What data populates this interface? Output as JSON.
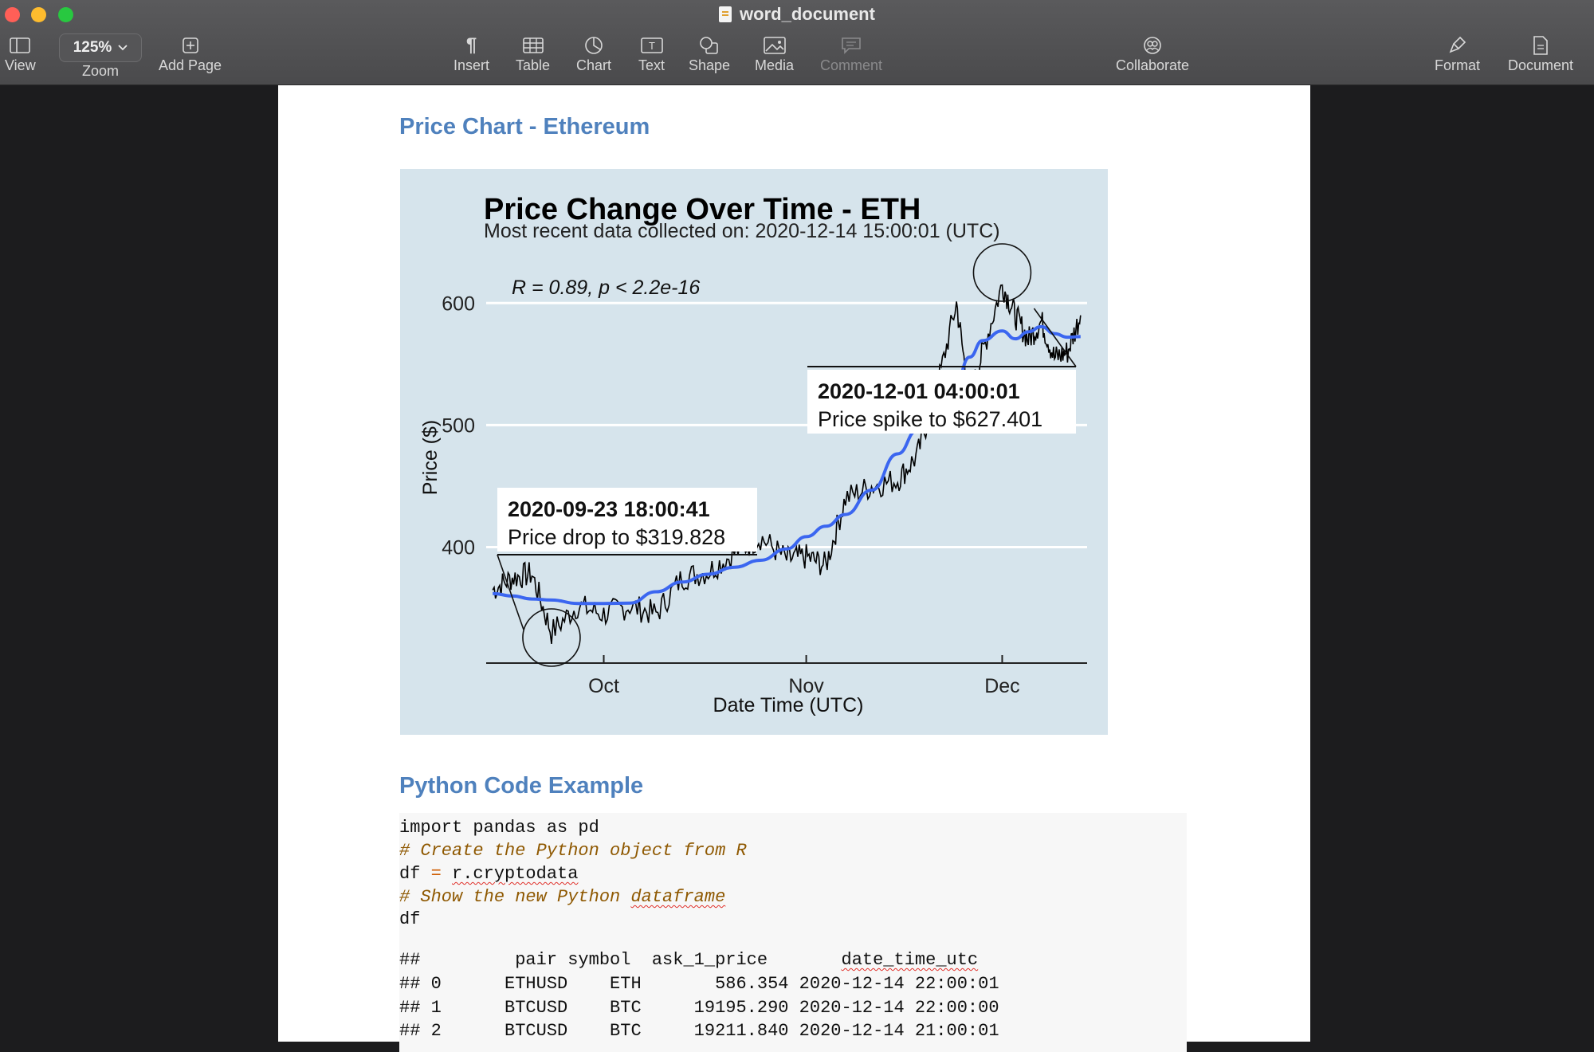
{
  "window": {
    "title": "word_document"
  },
  "toolbar": {
    "view": "View",
    "zoom_value": "125%",
    "zoom": "Zoom",
    "add_page": "Add Page",
    "insert": "Insert",
    "table": "Table",
    "chart": "Chart",
    "text": "Text",
    "shape": "Shape",
    "media": "Media",
    "comment": "Comment",
    "collaborate": "Collaborate",
    "format": "Format",
    "document": "Document"
  },
  "document": {
    "heading1": "Price Chart - Ethereum",
    "heading2": "Python Code Example"
  },
  "chart_data": {
    "type": "line",
    "title": "Price Change Over Time - ETH",
    "subtitle": "Most recent data collected on: 2020-12-14 15:00:01 (UTC)",
    "xlabel": "Date Time (UTC)",
    "ylabel": "Price ($)",
    "x_ticks": [
      "Oct",
      "Nov",
      "Dec"
    ],
    "y_ticks": [
      400,
      500,
      600
    ],
    "ylim": [
      305,
      625
    ],
    "xlim": [
      "2020-09-13",
      "2020-12-14"
    ],
    "grid": true,
    "stat_label": "R = 0.89, p < 2.2e-16",
    "series": [
      {
        "values_by_date": [
          [
            "2020-09-14",
            365
          ],
          [
            "2020-09-17",
            375
          ],
          [
            "2020-09-20",
            378
          ],
          [
            "2020-09-23",
            330
          ],
          [
            "2020-09-27",
            352
          ],
          [
            "2020-10-01",
            345
          ],
          [
            "2020-10-05",
            352
          ],
          [
            "2020-10-09",
            345
          ],
          [
            "2020-10-13",
            375
          ],
          [
            "2020-10-17",
            380
          ],
          [
            "2020-10-21",
            395
          ],
          [
            "2020-10-25",
            408
          ],
          [
            "2020-10-29",
            390
          ],
          [
            "2020-11-01",
            392
          ],
          [
            "2020-11-04",
            385
          ],
          [
            "2020-11-07",
            440
          ],
          [
            "2020-11-11",
            450
          ],
          [
            "2020-11-15",
            455
          ],
          [
            "2020-11-18",
            475
          ],
          [
            "2020-11-21",
            530
          ],
          [
            "2020-11-24",
            600
          ],
          [
            "2020-11-26",
            520
          ],
          [
            "2020-11-28",
            560
          ],
          [
            "2020-12-01",
            615
          ],
          [
            "2020-12-03",
            590
          ],
          [
            "2020-12-05",
            570
          ],
          [
            "2020-12-07",
            585
          ],
          [
            "2020-12-09",
            555
          ],
          [
            "2020-12-11",
            560
          ],
          [
            "2020-12-13",
            590
          ]
        ]
      }
    ],
    "trend_color": "#3b66f0",
    "annotations": [
      {
        "title": "2020-09-23 18:00:41",
        "text": "Price drop to $319.828",
        "date": "2020-09-23",
        "price": 319.828
      },
      {
        "title": "2020-12-01 04:00:01",
        "text": "Price spike to $627.401",
        "date": "2020-12-01",
        "price": 627.401
      }
    ]
  },
  "code": {
    "line1": "import pandas as pd",
    "line2": "# Create the Python object from R",
    "line3_var": "df",
    "line3_op": "=",
    "line3_val": "r.cryptodata",
    "line4_a": "# Show the new Python ",
    "line4_b": "dataframe",
    "line5": "df",
    "out_header_a": "##         pair symbol  ask_1_price       ",
    "out_header_b": "date_time_utc",
    "out_row0": "## 0      ETHUSD    ETH       586.354 2020-12-14 22:00:01",
    "out_row1": "## 1      BTCUSD    BTC     19195.290 2020-12-14 22:00:00",
    "out_row2": "## 2      BTCUSD    BTC     19211.840 2020-12-14 21:00:01"
  }
}
